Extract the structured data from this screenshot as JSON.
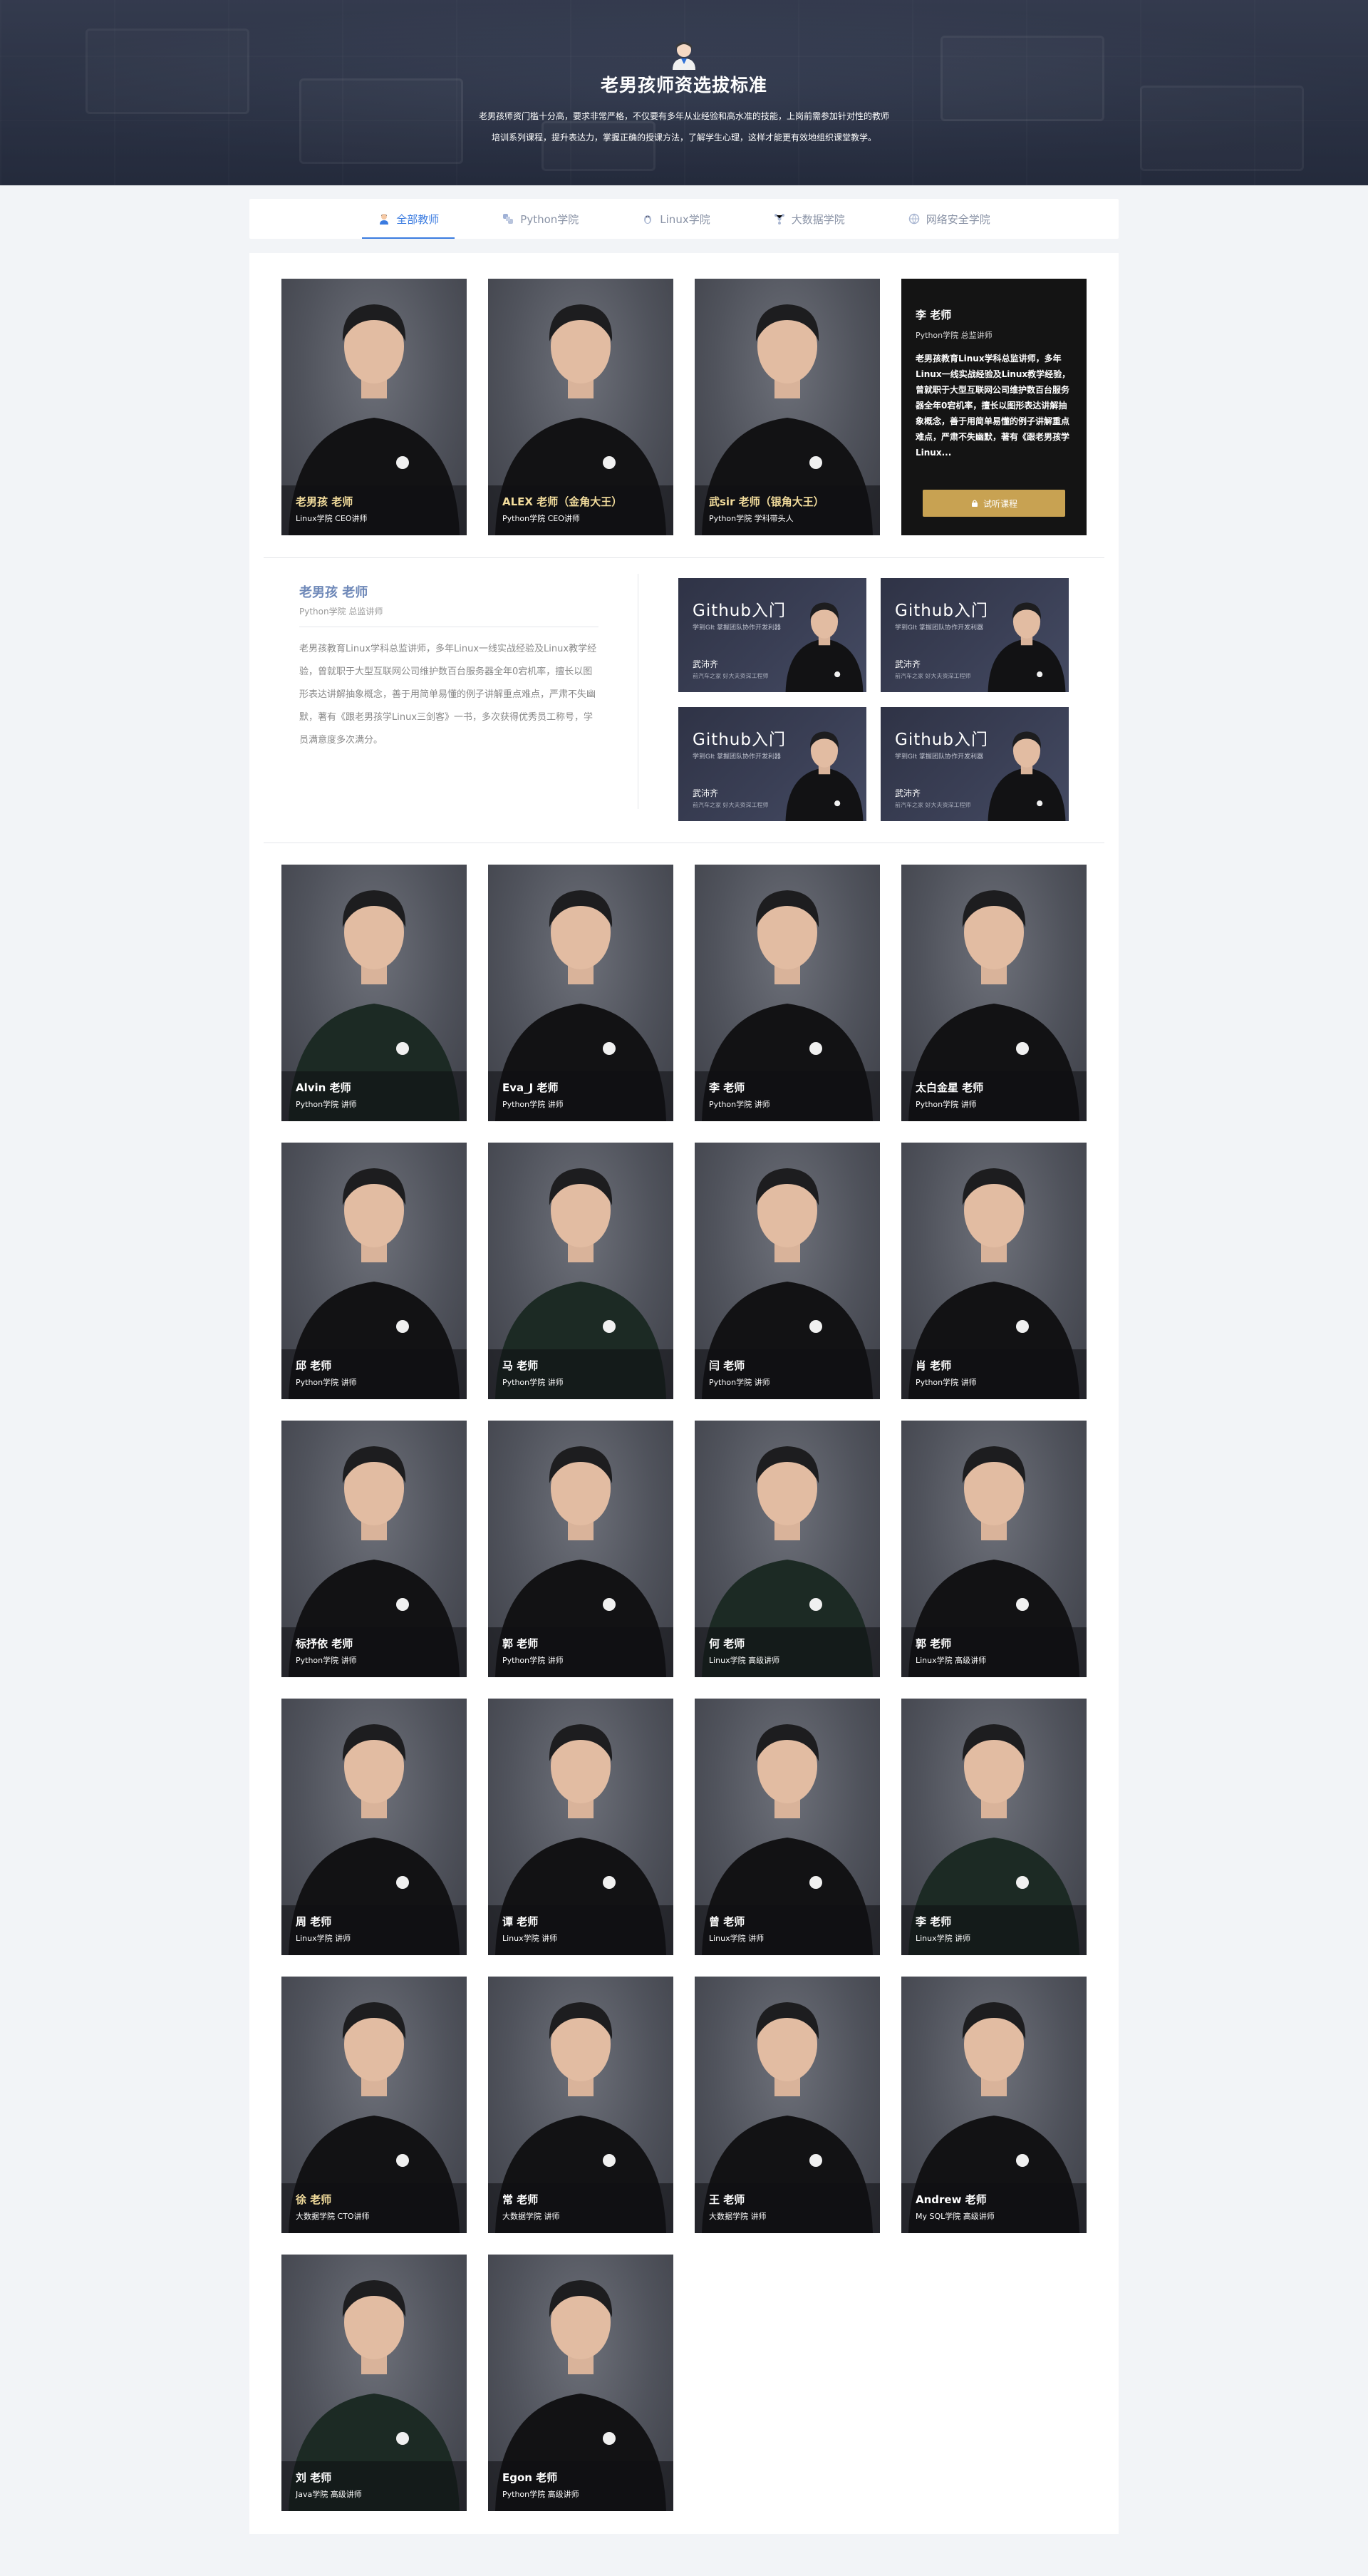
{
  "banner": {
    "title": "老男孩师资选拔标准",
    "desc_line1": "老男孩师资门槛十分高，要求非常严格，不仅要有多年从业经验和高水准的技能，上岗前需参加针对性的教师",
    "desc_line2": "培训系列课程，提升表达力，掌握正确的授课方法，了解学生心理，这样才能更有效地组织课堂教学。"
  },
  "tabs": [
    {
      "label": "全部教师",
      "icon": "teacher-icon",
      "active": true
    },
    {
      "label": "Python学院",
      "icon": "python-icon",
      "active": false
    },
    {
      "label": "Linux学院",
      "icon": "linux-icon",
      "active": false
    },
    {
      "label": "大数据学院",
      "icon": "bigdata-icon",
      "active": false
    },
    {
      "label": "网络安全学院",
      "icon": "security-icon",
      "active": false
    }
  ],
  "top_teachers": [
    {
      "name": "老男孩 老师",
      "role": "Linux学院 CEO讲师"
    },
    {
      "name": "ALEX 老师（金角大王）",
      "role": "Python学院 CEO讲师"
    },
    {
      "name": "武sir 老师（银角大王）",
      "role": "Python学院 学科带头人"
    }
  ],
  "detail_card": {
    "name": "李 老师",
    "role": "Python学院 总监讲师",
    "desc": "老男孩教育Linux学科总监讲师，多年Linux一线实战经验及Linux教学经验，曾就职于大型互联网公司维护数百台服务器全年0宕机率，擅长以图形表达讲解抽象概念，善于用简单易懂的例子讲解重点难点，严肃不失幽默，著有《跟老男孩学Linux...",
    "button": "试听课程"
  },
  "featured": {
    "name": "老男孩 老师",
    "role": "Python学院 总监讲师",
    "desc": "老男孩教育Linux学科总监讲师，多年Linux一线实战经验及Linux教学经验，曾就职于大型互联网公司维护数百台服务器全年0宕机率，擅长以图形表达讲解抽象概念，善于用简单易懂的例子讲解重点难点，严肃不失幽默，著有《跟老男孩学Linux三剑客》一书，多次获得优秀员工称号，学员满意度多次满分。",
    "courses": [
      {
        "title": "Github入门",
        "sub": "学到GIt  掌握团队协作开发利器",
        "teacher": "武沛齐",
        "note": "前汽车之家 好大夫资深工程师"
      },
      {
        "title": "Github入门",
        "sub": "学到GIt  掌握团队协作开发利器",
        "teacher": "武沛齐",
        "note": "前汽车之家 好大夫资深工程师"
      },
      {
        "title": "Github入门",
        "sub": "学到GIt  掌握团队协作开发利器",
        "teacher": "武沛齐",
        "note": "前汽车之家 好大夫资深工程师"
      },
      {
        "title": "Github入门",
        "sub": "学到GIt  掌握团队协作开发利器",
        "teacher": "武沛齐",
        "note": "前汽车之家 好大夫资深工程师"
      }
    ]
  },
  "teachers": [
    {
      "name": "Alvin 老师",
      "role": "Python学院 讲师"
    },
    {
      "name": "Eva_J 老师",
      "role": "Python学院 讲师"
    },
    {
      "name": "李 老师",
      "role": "Python学院 讲师"
    },
    {
      "name": "太白金星 老师",
      "role": "Python学院 讲师"
    },
    {
      "name": "邱 老师",
      "role": "Python学院 讲师"
    },
    {
      "name": "马 老师",
      "role": "Python学院 讲师"
    },
    {
      "name": "闫 老师",
      "role": "Python学院 讲师"
    },
    {
      "name": "肖 老师",
      "role": "Python学院 讲师"
    },
    {
      "name": "标抒依 老师",
      "role": "Python学院 讲师"
    },
    {
      "name": "郭 老师",
      "role": "Python学院 讲师"
    },
    {
      "name": "何 老师",
      "role": "Linux学院 高级讲师"
    },
    {
      "name": "郭 老师",
      "role": "Linux学院 高级讲师"
    },
    {
      "name": "周 老师",
      "role": "Linux学院 讲师"
    },
    {
      "name": "谭 老师",
      "role": "Linux学院 讲师"
    },
    {
      "name": "曾 老师",
      "role": "Linux学院 讲师"
    },
    {
      "name": "李 老师",
      "role": "Linux学院 讲师"
    },
    {
      "name": "徐 老师",
      "role": "大数据学院 CTO讲师",
      "gold": true
    },
    {
      "name": "常 老师",
      "role": "大数据学院 讲师"
    },
    {
      "name": "王 老师",
      "role": "大数据学院 讲师"
    },
    {
      "name": "Andrew 老师",
      "role": "My SQL学院 高级讲师"
    },
    {
      "name": "刘 老师",
      "role": "Java学院 高级讲师"
    },
    {
      "name": "Egon 老师",
      "role": "Python学院 高级讲师"
    }
  ]
}
